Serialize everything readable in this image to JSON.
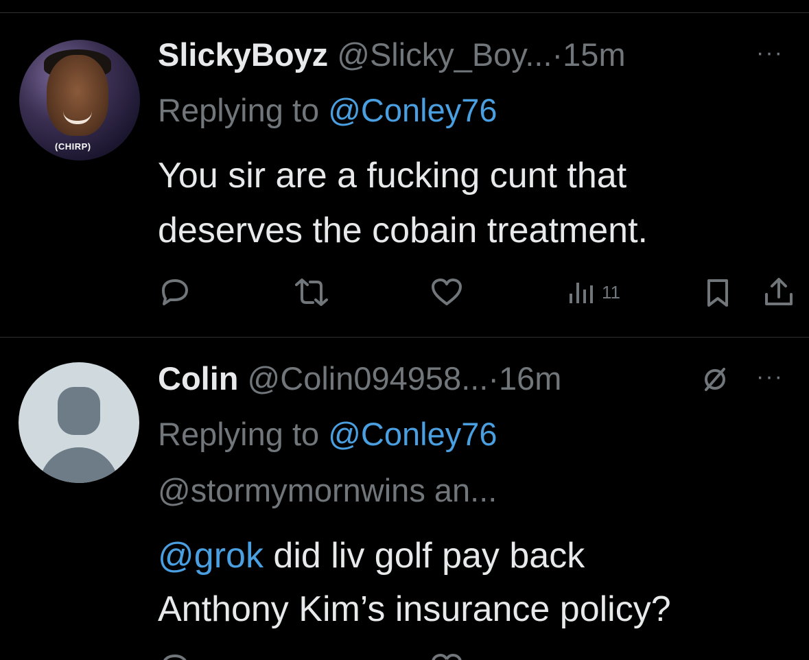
{
  "tweets": [
    {
      "display_name": "SlickyBoyz",
      "handle": "@Slicky_Boy...",
      "separator": "·",
      "time": "15m",
      "avatar_caption": "(CHIRP)",
      "replying_prefix": "Replying to",
      "replying_to": "@Conley76",
      "text_lines": [
        "You sir are a fucking cunt that",
        "deserves the cobain treatment."
      ],
      "actions": {
        "reply_icon": "reply-icon",
        "retweet_icon": "retweet-icon",
        "like_icon": "heart-icon",
        "views_icon": "views-icon",
        "views_count": "11",
        "bookmark_icon": "bookmark-icon",
        "share_icon": "share-icon"
      }
    },
    {
      "display_name": "Colin",
      "handle": "@Colin094958...",
      "separator": "·",
      "time": "16m",
      "replying_prefix": "Replying to",
      "replying_to": "@Conley76",
      "replying_more": "@stormymornwins an...",
      "mention": "@grok",
      "text_line_1_rest": " did liv golf pay back",
      "text_line_2": "Anthony Kim’s insurance policy?"
    }
  ],
  "colors": {
    "background": "#000000",
    "text": "#e7e9ea",
    "muted": "#71767b",
    "link": "#4a9fe0",
    "divider": "#2f3336"
  }
}
